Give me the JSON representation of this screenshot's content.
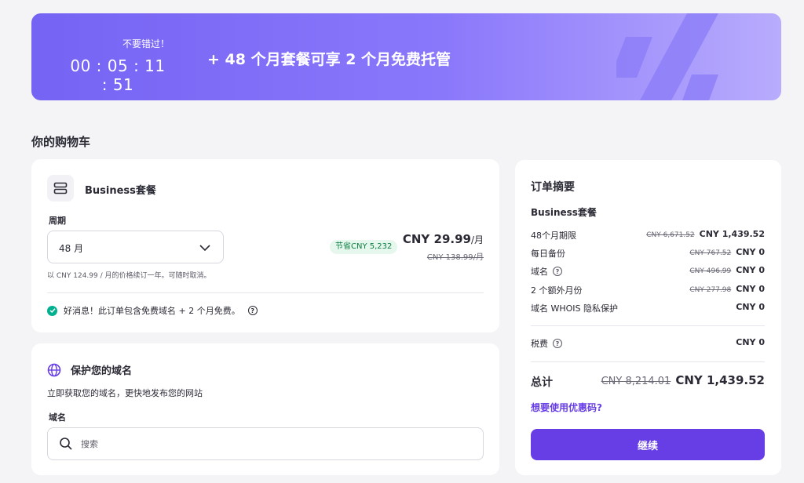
{
  "banner": {
    "timer_label": "不要错过！",
    "timer": "00 : 05 : 11 : 51",
    "promo_text": "+ 48 个月套餐可享 2 个月免费托管",
    "deco_icon": "percent-icon"
  },
  "cart": {
    "title": "你的购物车",
    "plan": {
      "icon": "server-icon",
      "name": "Business套餐",
      "period_label": "周期",
      "period_value": "48 月",
      "save_badge": "节省CNY 5,232",
      "price": "CNY 29.99",
      "price_unit": "/月",
      "old_price": "CNY 138.99/月",
      "renew_note": "以 CNY 124.99 / 月的价格续订一年。可随时取消。",
      "good_news": "好消息！此订单包含免费域名 + 2 个月免费。"
    },
    "domain": {
      "icon": "globe-icon",
      "title": "保护您的域名",
      "subtitle": "立即获取您的域名，更快地发布您的网站",
      "field_label": "域名",
      "search_placeholder": "搜索",
      "search_value": ""
    }
  },
  "summary": {
    "title": "订单摘要",
    "plan_name": "Business套餐",
    "rows": [
      {
        "label": "48个月期限",
        "old": "CNY 6,671.52",
        "amount": "CNY 1,439.52"
      },
      {
        "label": "每日备份",
        "old": "CNY 767.52",
        "amount": "CNY 0"
      },
      {
        "label": "域名",
        "old": "CNY 496.99",
        "amount": "CNY 0"
      },
      {
        "label": "2 个额外月份",
        "old": "CNY 277.98",
        "amount": "CNY 0"
      },
      {
        "label": "域名 WHOIS 隐私保护",
        "old": "",
        "amount": "CNY 0"
      }
    ],
    "tax": {
      "label": "税费",
      "amount": "CNY 0"
    },
    "total": {
      "label": "总计",
      "old": "CNY 8,214.01",
      "amount": "CNY 1,439.52"
    },
    "coupon_link": "想要使用优惠码?",
    "continue_label": "继续"
  },
  "colors": {
    "accent": "#673de6",
    "banner_start": "#7563f4",
    "success": "#00b090"
  }
}
